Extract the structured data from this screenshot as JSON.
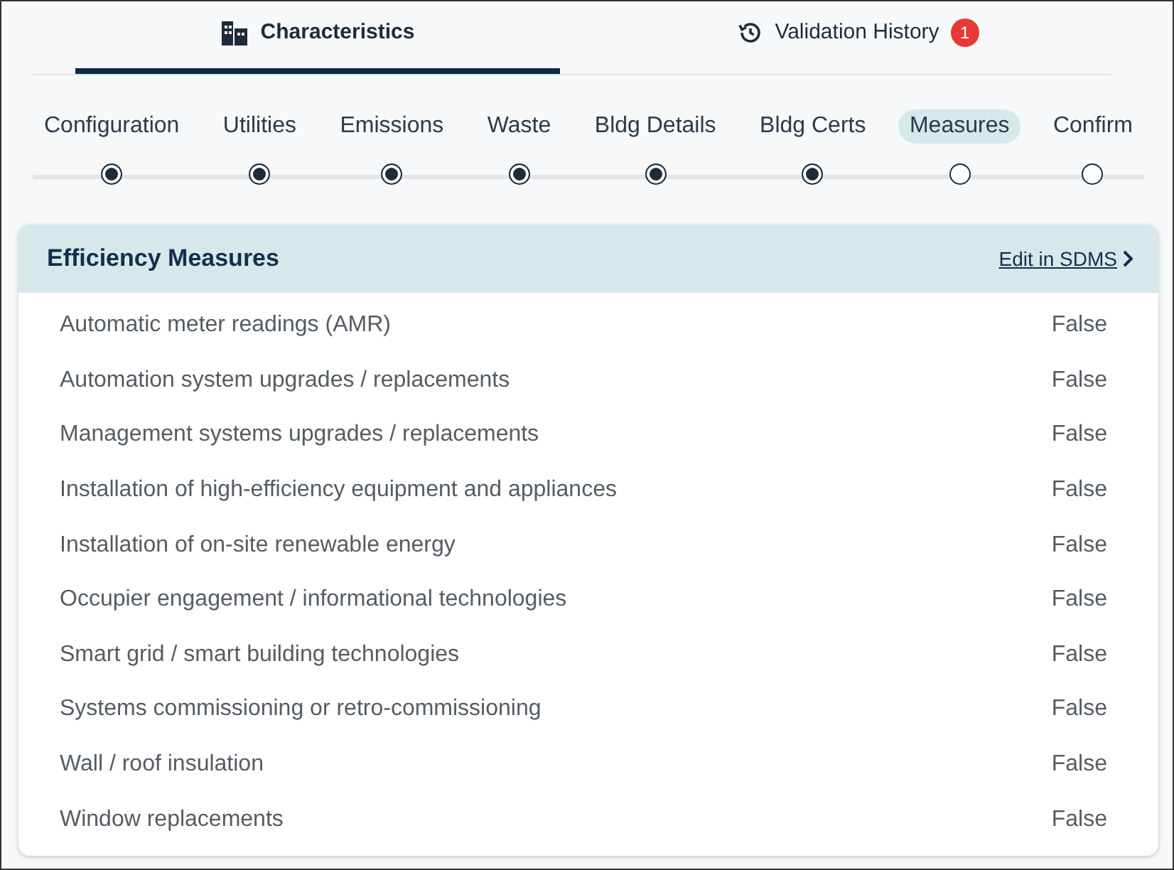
{
  "tabs": [
    {
      "label": "Characteristics",
      "kind": "building",
      "selected": true
    },
    {
      "label": "Validation History",
      "kind": "history",
      "selected": false,
      "badge": "1"
    }
  ],
  "steps": [
    {
      "label": "Configuration",
      "done": true,
      "selected": false
    },
    {
      "label": "Utilities",
      "done": true,
      "selected": false
    },
    {
      "label": "Emissions",
      "done": true,
      "selected": false
    },
    {
      "label": "Waste",
      "done": true,
      "selected": false
    },
    {
      "label": "Bldg Details",
      "done": true,
      "selected": false
    },
    {
      "label": "Bldg Certs",
      "done": true,
      "selected": false
    },
    {
      "label": "Measures",
      "done": false,
      "selected": true
    },
    {
      "label": "Confirm",
      "done": false,
      "selected": false
    }
  ],
  "card": {
    "title": "Efficiency Measures",
    "link": "Edit in SDMS",
    "rows": [
      {
        "label": "Automatic meter readings (AMR)",
        "value": "False"
      },
      {
        "label": "Automation system upgrades / replacements",
        "value": "False"
      },
      {
        "label": "Management systems upgrades / replacements",
        "value": "False"
      },
      {
        "label": "Installation of high-efficiency equipment and appliances",
        "value": "False"
      },
      {
        "label": "Installation of on-site renewable energy",
        "value": "False"
      },
      {
        "label": "Occupier engagement / informational technologies",
        "value": "False"
      },
      {
        "label": "Smart grid / smart building technologies",
        "value": "False"
      },
      {
        "label": "Systems commissioning or retro-commissioning",
        "value": "False"
      },
      {
        "label": "Wall / roof insulation",
        "value": "False"
      },
      {
        "label": "Window replacements",
        "value": "False"
      }
    ]
  }
}
